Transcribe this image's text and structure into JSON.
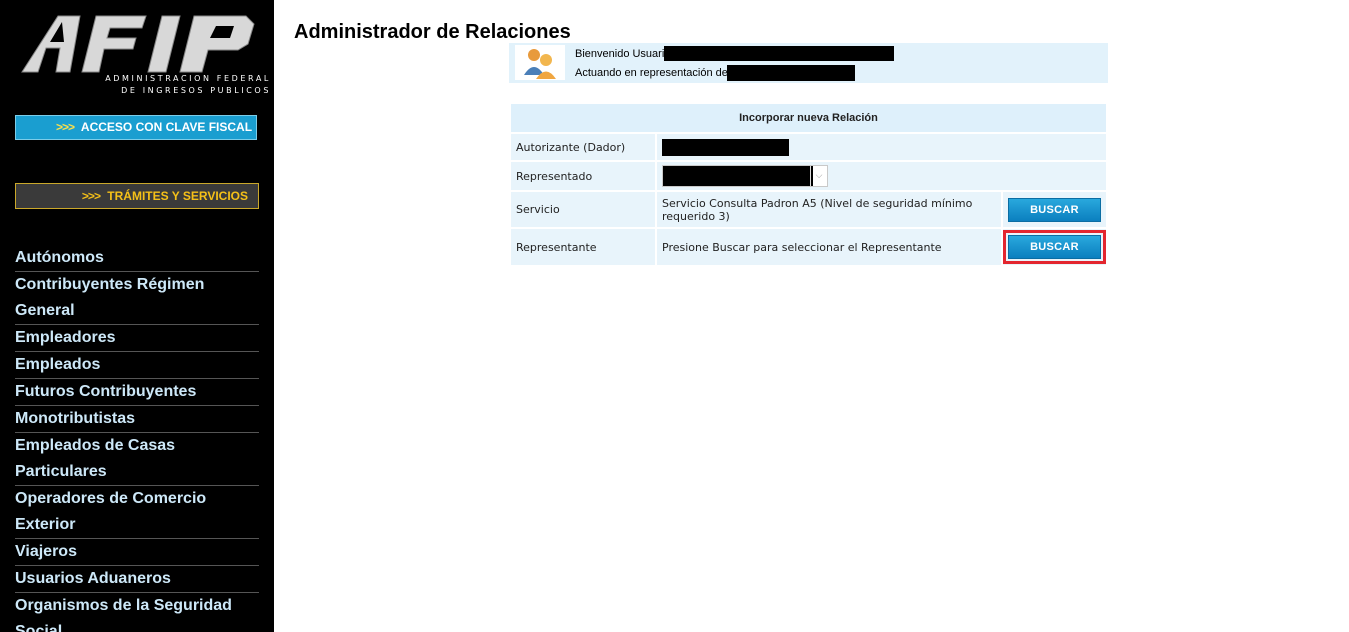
{
  "sidebar": {
    "logo_subtitle_1": "ADMINISTRACION FEDERAL",
    "logo_subtitle_2": "DE INGRESOS PUBLICOS",
    "clave_arrows": ">>>",
    "clave_label": "ACCESO CON CLAVE FISCAL",
    "tramites_arrows": ">>>",
    "tramites_label": "TRÁMITES Y SERVICIOS",
    "items": [
      "Autónomos",
      "Contribuyentes Régimen General",
      "Empleadores",
      "Empleados",
      "Futuros Contribuyentes",
      "Monotributistas",
      "Empleados de Casas Particulares",
      "Operadores de Comercio Exterior",
      "Viajeros",
      "Usuarios Aduaneros",
      "Organismos de la Seguridad Social"
    ]
  },
  "main": {
    "title": "Administrador de Relaciones",
    "welcome": {
      "greeting": "Bienvenido Usuario",
      "acting": "Actuando en representación de"
    },
    "form": {
      "header": "Incorporar nueva Relación",
      "autorizante_label": "Autorizante (Dador)",
      "representado_label": "Representado",
      "servicio_label": "Servicio",
      "servicio_value": "Servicio Consulta Padron A5 (Nivel de seguridad mínimo requerido 3)",
      "representante_label": "Representante",
      "representante_value": "Presione Buscar para seleccionar el Representante",
      "buscar_label": "BUSCAR"
    }
  },
  "colors": {
    "sidebar_bg": "#000000",
    "clave_btn": "#1a9ed0",
    "tramites_text": "#f5c018",
    "nav_text": "#cde8f8",
    "highlight": "#e3262f"
  }
}
